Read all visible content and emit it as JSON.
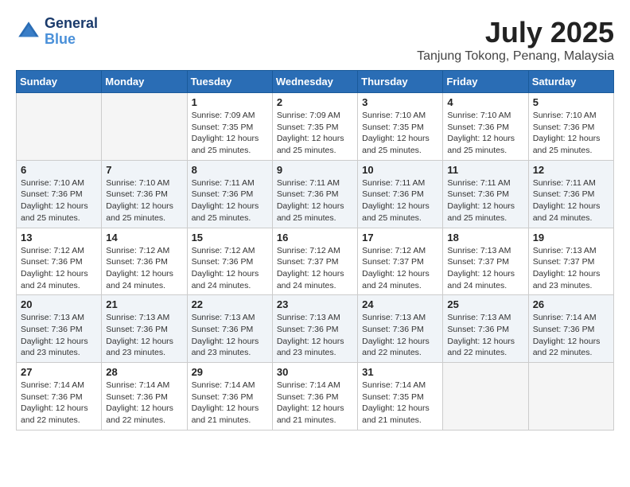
{
  "logo": {
    "line1": "General",
    "line2": "Blue"
  },
  "title": "July 2025",
  "location": "Tanjung Tokong, Penang, Malaysia",
  "days_of_week": [
    "Sunday",
    "Monday",
    "Tuesday",
    "Wednesday",
    "Thursday",
    "Friday",
    "Saturday"
  ],
  "weeks": [
    [
      {
        "num": "",
        "sunrise": "",
        "sunset": "",
        "daylight": ""
      },
      {
        "num": "",
        "sunrise": "",
        "sunset": "",
        "daylight": ""
      },
      {
        "num": "1",
        "sunrise": "Sunrise: 7:09 AM",
        "sunset": "Sunset: 7:35 PM",
        "daylight": "Daylight: 12 hours and 25 minutes."
      },
      {
        "num": "2",
        "sunrise": "Sunrise: 7:09 AM",
        "sunset": "Sunset: 7:35 PM",
        "daylight": "Daylight: 12 hours and 25 minutes."
      },
      {
        "num": "3",
        "sunrise": "Sunrise: 7:10 AM",
        "sunset": "Sunset: 7:35 PM",
        "daylight": "Daylight: 12 hours and 25 minutes."
      },
      {
        "num": "4",
        "sunrise": "Sunrise: 7:10 AM",
        "sunset": "Sunset: 7:36 PM",
        "daylight": "Daylight: 12 hours and 25 minutes."
      },
      {
        "num": "5",
        "sunrise": "Sunrise: 7:10 AM",
        "sunset": "Sunset: 7:36 PM",
        "daylight": "Daylight: 12 hours and 25 minutes."
      }
    ],
    [
      {
        "num": "6",
        "sunrise": "Sunrise: 7:10 AM",
        "sunset": "Sunset: 7:36 PM",
        "daylight": "Daylight: 12 hours and 25 minutes."
      },
      {
        "num": "7",
        "sunrise": "Sunrise: 7:10 AM",
        "sunset": "Sunset: 7:36 PM",
        "daylight": "Daylight: 12 hours and 25 minutes."
      },
      {
        "num": "8",
        "sunrise": "Sunrise: 7:11 AM",
        "sunset": "Sunset: 7:36 PM",
        "daylight": "Daylight: 12 hours and 25 minutes."
      },
      {
        "num": "9",
        "sunrise": "Sunrise: 7:11 AM",
        "sunset": "Sunset: 7:36 PM",
        "daylight": "Daylight: 12 hours and 25 minutes."
      },
      {
        "num": "10",
        "sunrise": "Sunrise: 7:11 AM",
        "sunset": "Sunset: 7:36 PM",
        "daylight": "Daylight: 12 hours and 25 minutes."
      },
      {
        "num": "11",
        "sunrise": "Sunrise: 7:11 AM",
        "sunset": "Sunset: 7:36 PM",
        "daylight": "Daylight: 12 hours and 25 minutes."
      },
      {
        "num": "12",
        "sunrise": "Sunrise: 7:11 AM",
        "sunset": "Sunset: 7:36 PM",
        "daylight": "Daylight: 12 hours and 24 minutes."
      }
    ],
    [
      {
        "num": "13",
        "sunrise": "Sunrise: 7:12 AM",
        "sunset": "Sunset: 7:36 PM",
        "daylight": "Daylight: 12 hours and 24 minutes."
      },
      {
        "num": "14",
        "sunrise": "Sunrise: 7:12 AM",
        "sunset": "Sunset: 7:36 PM",
        "daylight": "Daylight: 12 hours and 24 minutes."
      },
      {
        "num": "15",
        "sunrise": "Sunrise: 7:12 AM",
        "sunset": "Sunset: 7:36 PM",
        "daylight": "Daylight: 12 hours and 24 minutes."
      },
      {
        "num": "16",
        "sunrise": "Sunrise: 7:12 AM",
        "sunset": "Sunset: 7:37 PM",
        "daylight": "Daylight: 12 hours and 24 minutes."
      },
      {
        "num": "17",
        "sunrise": "Sunrise: 7:12 AM",
        "sunset": "Sunset: 7:37 PM",
        "daylight": "Daylight: 12 hours and 24 minutes."
      },
      {
        "num": "18",
        "sunrise": "Sunrise: 7:13 AM",
        "sunset": "Sunset: 7:37 PM",
        "daylight": "Daylight: 12 hours and 24 minutes."
      },
      {
        "num": "19",
        "sunrise": "Sunrise: 7:13 AM",
        "sunset": "Sunset: 7:37 PM",
        "daylight": "Daylight: 12 hours and 23 minutes."
      }
    ],
    [
      {
        "num": "20",
        "sunrise": "Sunrise: 7:13 AM",
        "sunset": "Sunset: 7:36 PM",
        "daylight": "Daylight: 12 hours and 23 minutes."
      },
      {
        "num": "21",
        "sunrise": "Sunrise: 7:13 AM",
        "sunset": "Sunset: 7:36 PM",
        "daylight": "Daylight: 12 hours and 23 minutes."
      },
      {
        "num": "22",
        "sunrise": "Sunrise: 7:13 AM",
        "sunset": "Sunset: 7:36 PM",
        "daylight": "Daylight: 12 hours and 23 minutes."
      },
      {
        "num": "23",
        "sunrise": "Sunrise: 7:13 AM",
        "sunset": "Sunset: 7:36 PM",
        "daylight": "Daylight: 12 hours and 23 minutes."
      },
      {
        "num": "24",
        "sunrise": "Sunrise: 7:13 AM",
        "sunset": "Sunset: 7:36 PM",
        "daylight": "Daylight: 12 hours and 22 minutes."
      },
      {
        "num": "25",
        "sunrise": "Sunrise: 7:13 AM",
        "sunset": "Sunset: 7:36 PM",
        "daylight": "Daylight: 12 hours and 22 minutes."
      },
      {
        "num": "26",
        "sunrise": "Sunrise: 7:14 AM",
        "sunset": "Sunset: 7:36 PM",
        "daylight": "Daylight: 12 hours and 22 minutes."
      }
    ],
    [
      {
        "num": "27",
        "sunrise": "Sunrise: 7:14 AM",
        "sunset": "Sunset: 7:36 PM",
        "daylight": "Daylight: 12 hours and 22 minutes."
      },
      {
        "num": "28",
        "sunrise": "Sunrise: 7:14 AM",
        "sunset": "Sunset: 7:36 PM",
        "daylight": "Daylight: 12 hours and 22 minutes."
      },
      {
        "num": "29",
        "sunrise": "Sunrise: 7:14 AM",
        "sunset": "Sunset: 7:36 PM",
        "daylight": "Daylight: 12 hours and 21 minutes."
      },
      {
        "num": "30",
        "sunrise": "Sunrise: 7:14 AM",
        "sunset": "Sunset: 7:36 PM",
        "daylight": "Daylight: 12 hours and 21 minutes."
      },
      {
        "num": "31",
        "sunrise": "Sunrise: 7:14 AM",
        "sunset": "Sunset: 7:35 PM",
        "daylight": "Daylight: 12 hours and 21 minutes."
      },
      {
        "num": "",
        "sunrise": "",
        "sunset": "",
        "daylight": ""
      },
      {
        "num": "",
        "sunrise": "",
        "sunset": "",
        "daylight": ""
      }
    ]
  ]
}
